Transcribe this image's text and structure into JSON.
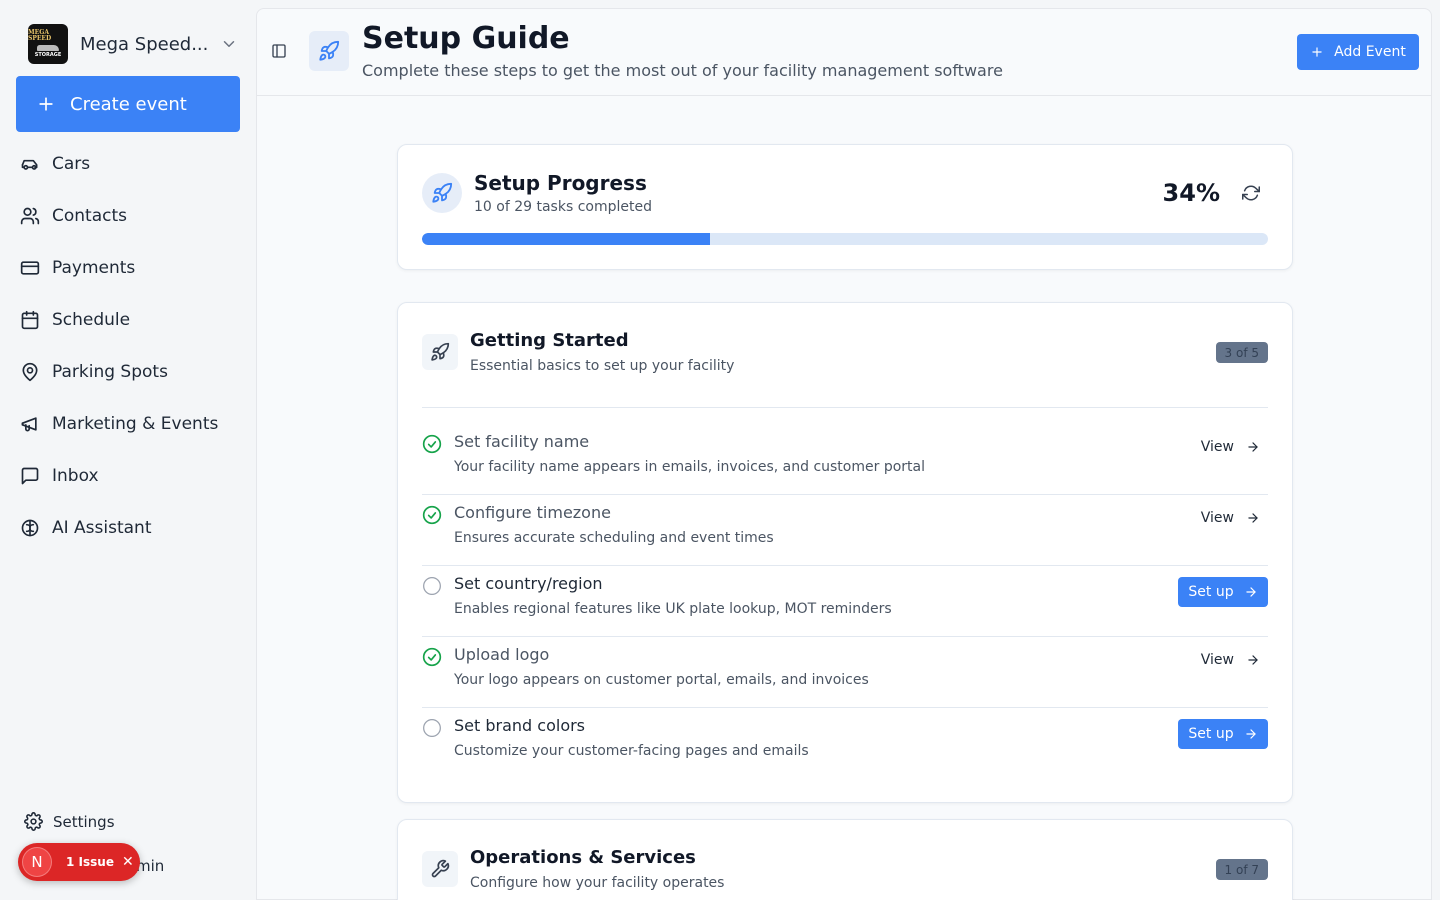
{
  "sidebar": {
    "org_name": "Mega Speed...",
    "logo_text": [
      "MEGA SPEED",
      "STORAGE"
    ],
    "create_label": "Create event",
    "items": [
      {
        "label": "Cars",
        "icon": "car-icon"
      },
      {
        "label": "Contacts",
        "icon": "users-icon"
      },
      {
        "label": "Payments",
        "icon": "credit-card-icon"
      },
      {
        "label": "Schedule",
        "icon": "calendar-icon"
      },
      {
        "label": "Parking Spots",
        "icon": "map-pin-icon"
      },
      {
        "label": "Marketing & Events",
        "icon": "megaphone-icon"
      },
      {
        "label": "Inbox",
        "icon": "message-square-icon"
      },
      {
        "label": "AI Assistant",
        "icon": "brain-icon"
      }
    ],
    "settings_label": "Settings",
    "user_fragment": "min"
  },
  "issue_badge": {
    "avatar_letter": "N",
    "label": "1 Issue",
    "close": "✕"
  },
  "header": {
    "title": "Setup Guide",
    "subtitle": "Complete these steps to get the most out of your facility management software",
    "add_label": "Add Event"
  },
  "progress": {
    "title": "Setup Progress",
    "subtitle": "10 of 29 tasks completed",
    "percent_label": "34%",
    "fraction": 0.34
  },
  "sections": [
    {
      "title": "Getting Started",
      "subtitle": "Essential basics to set up your facility",
      "badge": "3 of 5",
      "tasks": [
        {
          "title": "Set facility name",
          "desc": "Your facility name appears in emails, invoices, and customer portal",
          "done": true,
          "action": "View"
        },
        {
          "title": "Configure timezone",
          "desc": "Ensures accurate scheduling and event times",
          "done": true,
          "action": "View"
        },
        {
          "title": "Set country/region",
          "desc": "Enables regional features like UK plate lookup, MOT reminders",
          "done": false,
          "action": "Set up"
        },
        {
          "title": "Upload logo",
          "desc": "Your logo appears on customer portal, emails, and invoices",
          "done": true,
          "action": "View"
        },
        {
          "title": "Set brand colors",
          "desc": "Customize your customer-facing pages and emails",
          "done": false,
          "action": "Set up"
        }
      ]
    },
    {
      "title": "Operations & Services",
      "subtitle": "Configure how your facility operates",
      "badge": "1 of 7"
    }
  ],
  "colors": {
    "accent": "#3b82f6",
    "success": "#16a34a",
    "danger": "#dc2626"
  }
}
